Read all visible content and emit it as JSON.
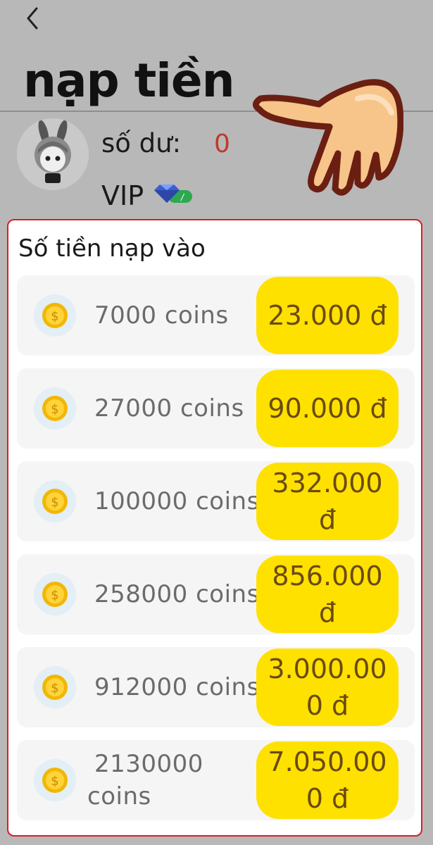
{
  "header": {
    "back_icon": "chevron-left-icon",
    "title": "nạp tiền"
  },
  "account": {
    "avatar": "avatar",
    "balance_label": "số dư:",
    "balance_value": "0",
    "vip_label": "VIP",
    "vip_badge_icon": "diamond-badge-icon"
  },
  "decoration": {
    "hand_icon": "pointing-hand-icon"
  },
  "colors": {
    "background": "#b8b8b8",
    "panel_border": "#d61f26",
    "price_button": "#ffe100",
    "price_text": "#6a4a10",
    "balance_value": "#c0392b"
  },
  "recharge": {
    "title": "Số tiền nạp vào",
    "packages": [
      {
        "coins": "7000 coins",
        "price": "23.000 đ"
      },
      {
        "coins": "27000 coins",
        "price": "90.000 đ"
      },
      {
        "coins": "100000 coins",
        "price": "332.000 đ"
      },
      {
        "coins": "258000 coins",
        "price": "856.000 đ"
      },
      {
        "coins": "912000 coins",
        "price": "3.000.000 đ"
      },
      {
        "coins": "2130000 coins",
        "price": "7.050.000 đ"
      }
    ]
  }
}
